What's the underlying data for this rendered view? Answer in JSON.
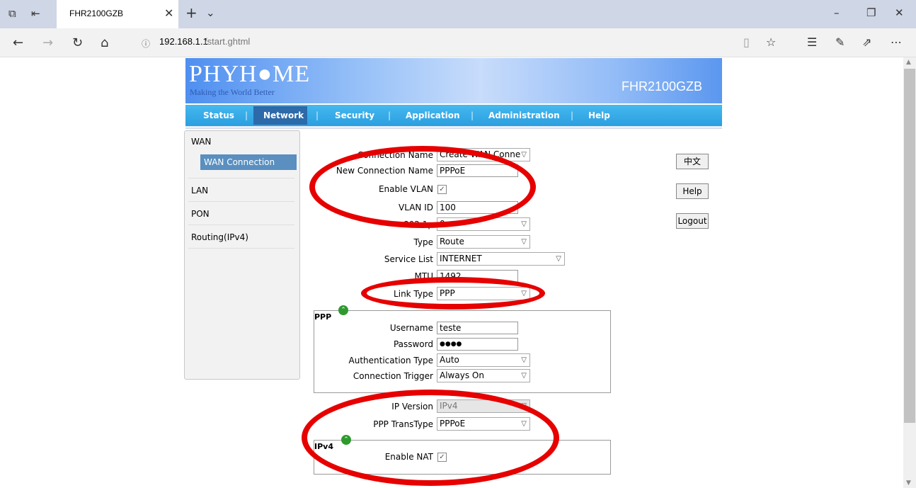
{
  "browser": {
    "tab_title": "FHR2100GZB",
    "url_host": "192.168.1.1",
    "url_path": "/start.ghtml",
    "info_icon": "info-icon"
  },
  "router": {
    "logo": "PHYH●ME",
    "slogan": "Making the World Better",
    "model": "FHR2100GZB",
    "menu": [
      "Status",
      "Network",
      "Security",
      "Application",
      "Administration",
      "Help"
    ],
    "active_menu": "Network",
    "sidebar": {
      "wan": "WAN",
      "wan_connection": "WAN Connection",
      "lan": "LAN",
      "pon": "PON",
      "routing": "Routing(IPv4)"
    },
    "buttons": {
      "lang": "中文",
      "help": "Help",
      "logout": "Logout"
    }
  },
  "form": {
    "connection_name": {
      "label": "Connection Name",
      "value": "Create WAN Conne"
    },
    "new_connection_name": {
      "label": "New Connection Name",
      "value": "PPPoE"
    },
    "enable_vlan": {
      "label": "Enable VLAN",
      "checked": true
    },
    "vlan_id": {
      "label": "VLAN ID",
      "value": "100"
    },
    "p8021": {
      "label": "802.1p",
      "value": "0"
    },
    "type": {
      "label": "Type",
      "value": "Route"
    },
    "service_list": {
      "label": "Service List",
      "value": "INTERNET"
    },
    "mtu": {
      "label": "MTU",
      "value": "1492"
    },
    "link_type": {
      "label": "Link Type",
      "value": "PPP"
    },
    "ppp_legend": "PPP",
    "username": {
      "label": "Username",
      "value": "teste"
    },
    "password": {
      "label": "Password",
      "value": "●●●●"
    },
    "auth_type": {
      "label": "Authentication Type",
      "value": "Auto"
    },
    "conn_trigger": {
      "label": "Connection Trigger",
      "value": "Always On"
    },
    "ip_version": {
      "label": "IP Version",
      "value": "IPv4"
    },
    "ppp_transtype": {
      "label": "PPP TransType",
      "value": "PPPoE"
    },
    "ipv4_legend": "IPv4",
    "enable_nat": {
      "label": "Enable NAT",
      "checked": true
    }
  },
  "colors": {
    "annotation": "#e60000",
    "menu_bar": "#2b9ee0",
    "active_menu": "#2c6aa9"
  }
}
